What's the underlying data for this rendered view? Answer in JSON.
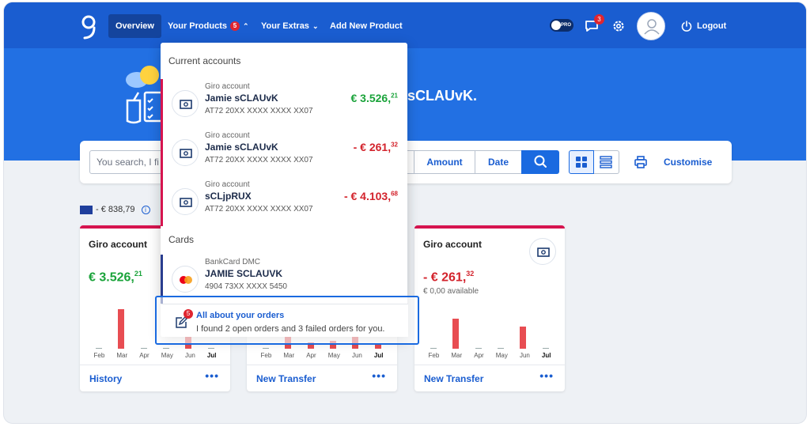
{
  "nav": {
    "overview": "Overview",
    "products": "Your Products",
    "products_badge": "5",
    "extras": "Your Extras",
    "add": "Add New Product",
    "pro_toggle": "PRO",
    "chat_badge": "3",
    "logout": "Logout"
  },
  "hero": {
    "greeting": "sCLAUvK."
  },
  "search": {
    "placeholder": "You search, I fi",
    "amount": "Amount",
    "date": "Date",
    "customise": "Customise"
  },
  "total": {
    "value": "- € 838,79"
  },
  "dropdown": {
    "current_header": "Current accounts",
    "cards_header": "Cards",
    "accounts": [
      {
        "type": "Giro account",
        "name": "Jamie sCLAUvK",
        "iban": "AT72 20XX XXXX XXXX XX07",
        "amount_main": "€ 3.526,",
        "amount_cents": "21"
      },
      {
        "type": "Giro account",
        "name": "Jamie sCLAUvK",
        "iban": "AT72 20XX XXXX XXXX XX07",
        "amount_main": "- € 261,",
        "amount_cents": "32"
      },
      {
        "type": "Giro account",
        "name": "sCLjpRUX",
        "iban": "AT72 20XX XXXX XXXX XX07",
        "amount_main": "- € 4.103,",
        "amount_cents": "68"
      }
    ],
    "cards": [
      {
        "type": "BankCard DMC",
        "name": "JAMIE SCLAUVK",
        "number": "4904 73XX XXXX 5450"
      }
    ]
  },
  "notice": {
    "badge": "5",
    "title": "All about your orders",
    "text": "I found 2 open orders and 3 failed orders for you."
  },
  "cards": [
    {
      "title": "Giro account",
      "amount_main": "€ 3.526,",
      "amount_cents": "21",
      "link": "History",
      "months": [
        "Feb",
        "Mar",
        "Apr",
        "May",
        "Jun",
        "Jul"
      ],
      "bars": [
        0,
        1.0,
        0,
        0,
        0.45,
        0
      ]
    },
    {
      "title": "",
      "amount_main": "",
      "amount_cents": "",
      "link": "New Transfer",
      "months": [
        "Feb",
        "Mar",
        "Apr",
        "May",
        "Jun",
        "Jul"
      ],
      "bars": [
        0,
        0.3,
        0.15,
        0.2,
        0.3,
        0.1
      ]
    },
    {
      "title": "Giro account",
      "amount_main": "- € 261,",
      "amount_cents": "32",
      "available": "€ 0,00 available",
      "link": "New Transfer",
      "months": [
        "Feb",
        "Mar",
        "Apr",
        "May",
        "Jun",
        "Jul"
      ],
      "bars": [
        0,
        0.75,
        0,
        0,
        0.55,
        0
      ]
    }
  ],
  "colors": {
    "primary": "#1a5dd0",
    "hero": "#2270e3",
    "positive": "#1aa33a",
    "negative": "#d3232c",
    "accent_stripe": "#d6144f"
  }
}
